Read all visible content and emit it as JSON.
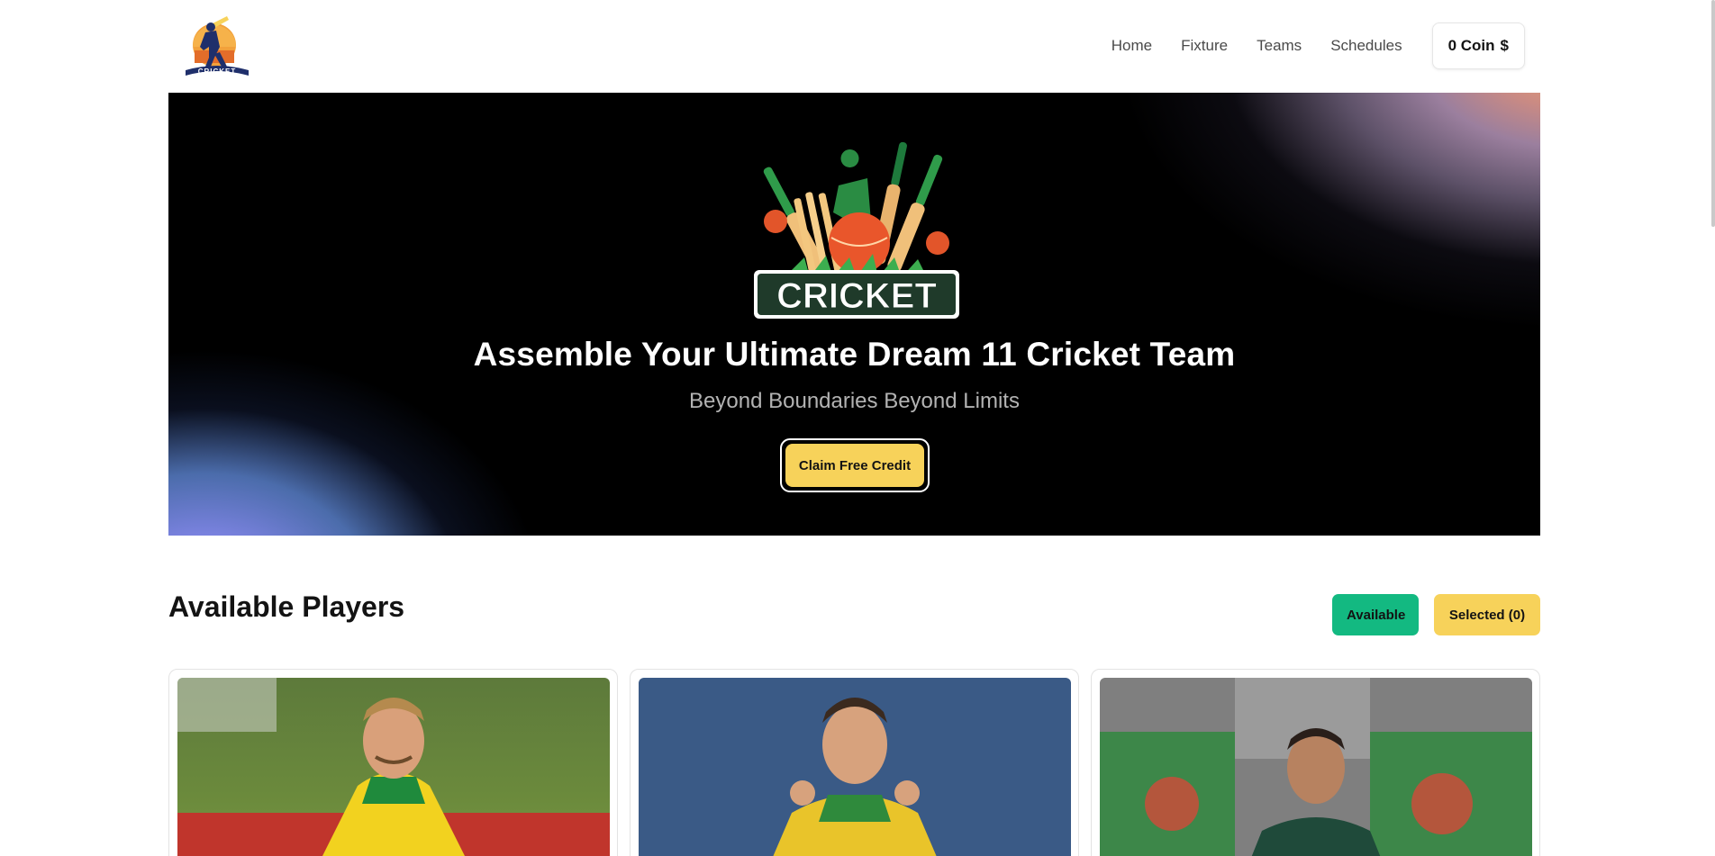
{
  "header": {
    "logo_text": "CRICKET",
    "nav": [
      {
        "label": "Home"
      },
      {
        "label": "Fixture"
      },
      {
        "label": "Teams"
      },
      {
        "label": "Schedules"
      }
    ],
    "coin": {
      "count_label": "0 Coin",
      "currency_symbol": "$"
    }
  },
  "hero": {
    "banner_text": "CRICKET",
    "title": "Assemble Your Ultimate Dream 11 Cricket Team",
    "subtitle": "Beyond Boundaries Beyond Limits",
    "cta_label": "Claim Free Credit"
  },
  "players": {
    "title": "Available Players",
    "tabs": {
      "available_label": "Available",
      "selected_label": "Selected (0)"
    }
  },
  "colors": {
    "accent_yellow": "#f7d25a",
    "accent_green": "#13b981",
    "hero_bg": "#000000"
  },
  "icons": [
    "cricket-logo-icon",
    "cricket-banner-icon"
  ]
}
